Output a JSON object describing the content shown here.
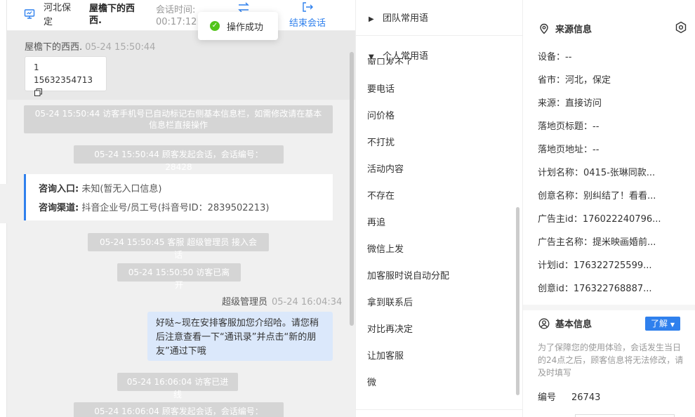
{
  "header": {
    "location": "河北保定",
    "visitor_name": "屋檐下的西西.",
    "session_time_label": "会话时间:",
    "session_time_value": "00:17:12",
    "end_label": "结束会话"
  },
  "toast": {
    "text": "操作成功"
  },
  "chat": {
    "first_msg": {
      "sender": "屋檐下的西西.",
      "time": "05-24 15:50:44",
      "line1": "1",
      "phone": "15632354713"
    },
    "system_msgs": [
      "05-24 15:50:44 访客手机号已自动标记右侧基本信息栏，如需修改请在基本信息栏直接操作",
      "05-24 15:50:44 顾客发起会话，会话编号：28428",
      "05-24 15:50:45 客服 超级管理员 接入会话",
      "05-24 15:50:50 访客已离开",
      "05-24 16:06:04 访客已进线",
      "05-24 16:06:04 顾客发起会话，会话编号：28429"
    ],
    "info_card": {
      "entry_label": "咨询入口:",
      "entry_value": "未知(暂无入口信息)",
      "channel_label": "咨询渠道:",
      "channel_value": "抖音企业号/员工号(抖音号ID：2839502213)"
    },
    "agent_msg": {
      "name": "超级管理员",
      "time": "05-24 16:04:34",
      "text": "好哒~现在安排客服加您介绍哈。请您稍后注意查看一下“通讯录”并点击“新的朋友”通过下哦"
    }
  },
  "phrases": {
    "team_group": "团队常用语",
    "personal_group": "个人常用语",
    "cut_item": "窗口发不了",
    "items": [
      "要电话",
      "问价格",
      "不打扰",
      "活动内容",
      "不存在",
      "再追",
      "微信上发",
      "加客服时说自动分配",
      "拿到联系后",
      "对比再决定",
      "让加客服",
      "微"
    ]
  },
  "source_info": {
    "title": "来源信息",
    "fields": [
      "设备：--",
      "省市：河北，保定",
      "来源：直接访问",
      "落地页标题：--",
      "落地页地址：--",
      "计划名称：0415-张琳同款...",
      "创意名称：别纠结了！看看...",
      "广告主id：176022240796...",
      "广告主名称：提米映画婚前...",
      "计划id：176322725599...",
      "创意id：176322768887..."
    ]
  },
  "basic_info": {
    "title": "基本信息",
    "know_label": "了解",
    "note": "为了保障您的使用体验，会话发生当日的24点之后，顾客信息将无法修改，请及时填写",
    "number_label": "编号",
    "number_value": "26743"
  },
  "colors": {
    "accent": "#2f80ed",
    "success": "#52c41a",
    "agent_bubble": "#dbe8fb",
    "system_msg": "#d5d5d5"
  }
}
